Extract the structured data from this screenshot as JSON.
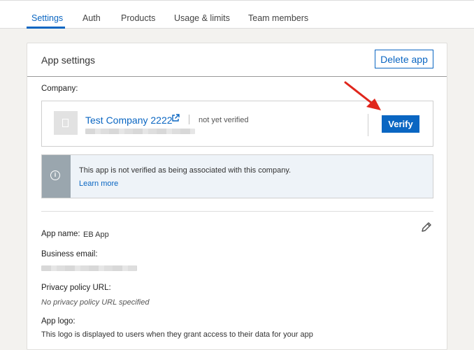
{
  "tabs": [
    {
      "label": "Settings",
      "active": true
    },
    {
      "label": "Auth"
    },
    {
      "label": "Products"
    },
    {
      "label": "Usage & limits"
    },
    {
      "label": "Team members"
    }
  ],
  "card": {
    "title": "App settings",
    "delete_label": "Delete app"
  },
  "company": {
    "section_label": "Company:",
    "name": "Test Company 2222",
    "status": "not yet verified",
    "verify_label": "Verify"
  },
  "info": {
    "message": "This app is not verified as being associated with this company.",
    "link": "Learn more"
  },
  "details": {
    "app_name_label": "App name:",
    "app_name_value": "EB App",
    "business_email_label": "Business email:",
    "privacy_label": "Privacy policy URL:",
    "privacy_value": "No privacy policy URL specified",
    "logo_label": "App logo:",
    "logo_desc": "This logo is displayed to users when they grant access to their data for your app"
  },
  "colors": {
    "accent": "#0a66c2",
    "annotation_arrow": "#e0261c"
  },
  "icons": [
    "external-link-icon",
    "info-icon",
    "pencil-icon",
    "company-placeholder-icon"
  ]
}
